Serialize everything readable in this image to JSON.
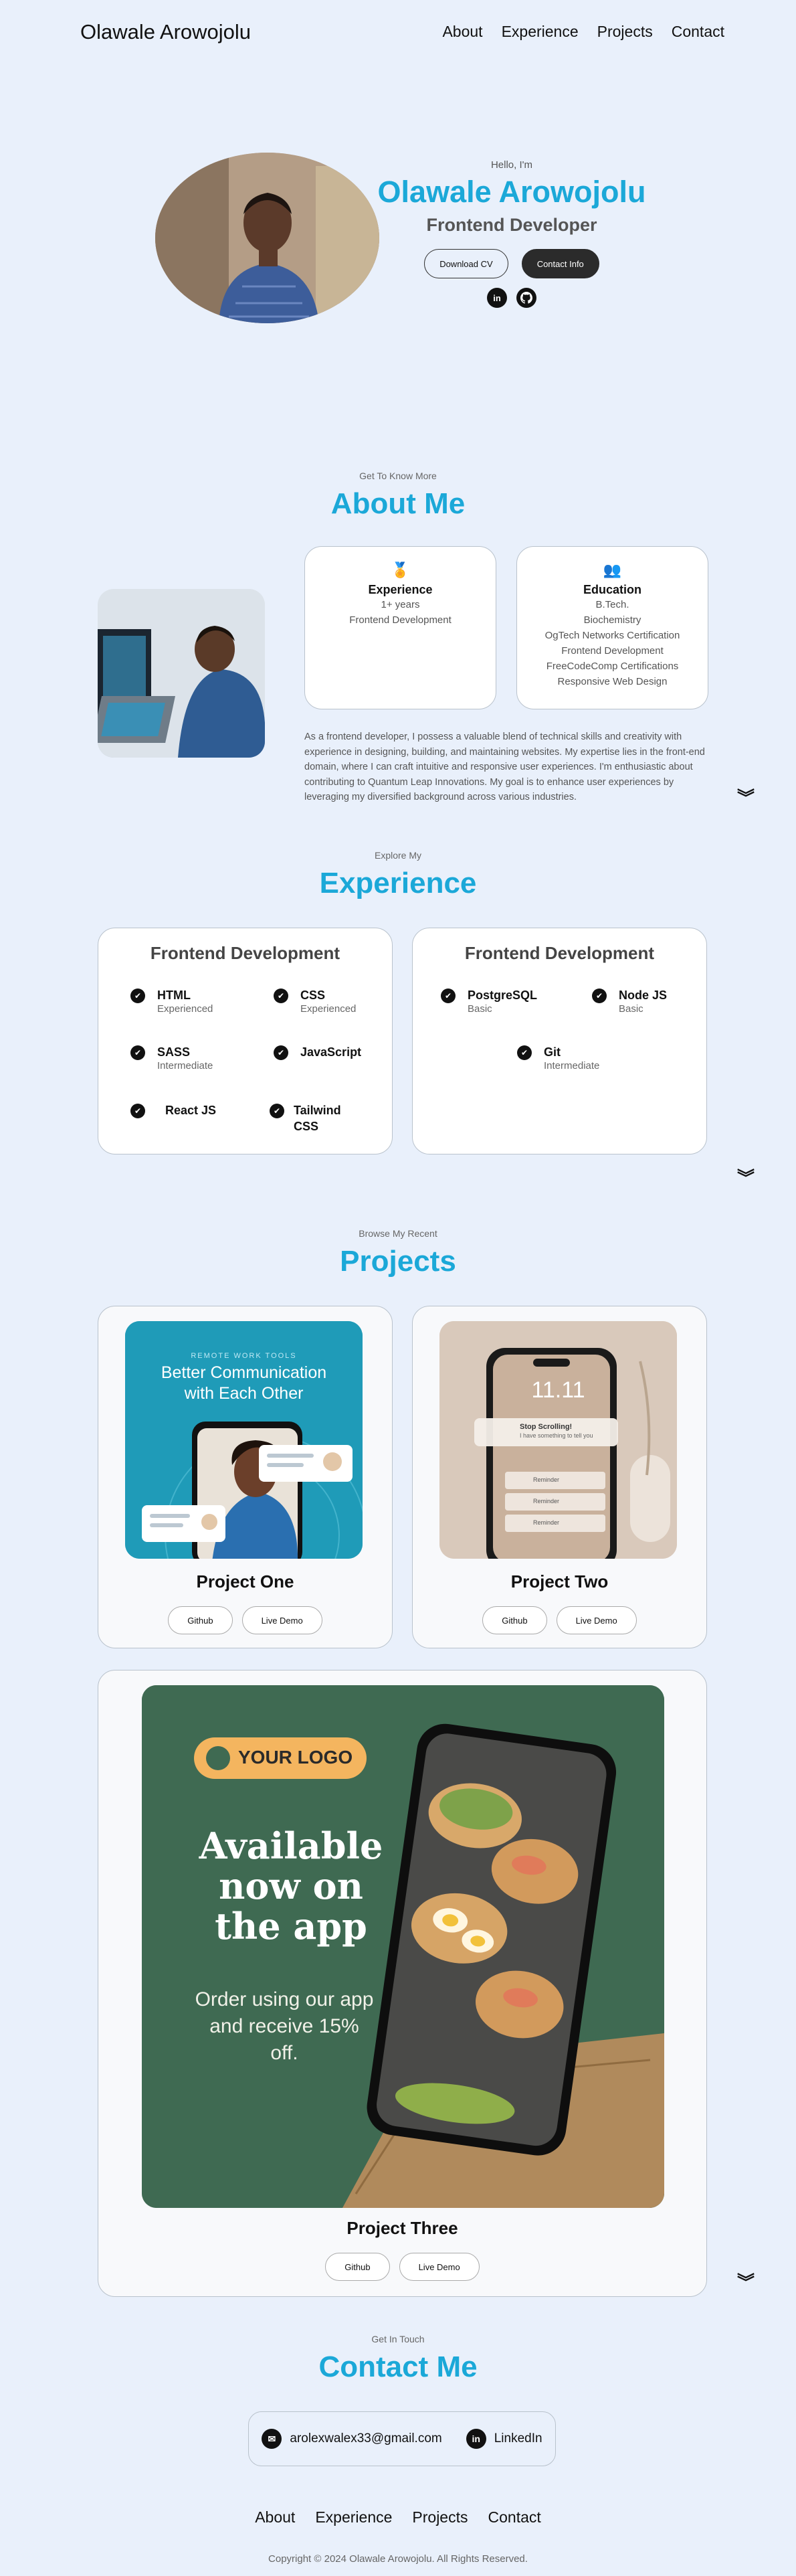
{
  "nav": {
    "logo": "Olawale Arowojolu",
    "links": [
      "About",
      "Experience",
      "Projects",
      "Contact"
    ]
  },
  "hero": {
    "greeting": "Hello, I'm",
    "name": "Olawale Arowojolu",
    "role": "Frontend Developer",
    "download_cv": "Download CV",
    "contact_info": "Contact Info",
    "social_icons": [
      "linkedin-icon",
      "github-icon"
    ]
  },
  "about": {
    "subtitle": "Get To Know More",
    "title": "About Me",
    "experience_card": {
      "icon": "medal-icon",
      "title": "Experience",
      "lines": [
        "1+ years",
        "Frontend Development"
      ]
    },
    "education_card": {
      "icon": "users-icon",
      "title": "Education",
      "lines": [
        "B.Tech.",
        "Biochemistry",
        "OgTech Networks Certification",
        "Frontend Development",
        "FreeCodeComp Certifications",
        "Responsive Web Design"
      ]
    },
    "paragraph": "As a frontend developer, I possess a valuable blend of technical skills and creativity with experience in designing, building, and maintaining websites. My expertise lies in the front-end domain, where I can craft intuitive and responsive user experiences. I'm enthusiastic about contributing to Quantum Leap Innovations. My goal is to enhance user experiences by leveraging my diversified background across various industries."
  },
  "experience": {
    "subtitle": "Explore My",
    "title": "Experience",
    "cards": [
      {
        "title": "Frontend Development",
        "skills": [
          {
            "name": "HTML",
            "level": "Experienced"
          },
          {
            "name": "CSS",
            "level": "Experienced"
          },
          {
            "name": "SASS",
            "level": "Intermediate"
          },
          {
            "name": "JavaScript",
            "level": ""
          },
          {
            "name": "React JS",
            "level": ""
          },
          {
            "name": "Tailwind CSS",
            "level": ""
          }
        ]
      },
      {
        "title": "Frontend Development",
        "skills": [
          {
            "name": "PostgreSQL",
            "level": "Basic"
          },
          {
            "name": "Node JS",
            "level": "Basic"
          },
          {
            "name": "Git",
            "level": "Intermediate"
          }
        ]
      }
    ]
  },
  "projects": {
    "subtitle": "Browse My Recent",
    "title": "Projects",
    "items": [
      {
        "title": "Project One",
        "github": "Github",
        "demo": "Live Demo",
        "image": {
          "kicker": "REMOTE WORK TOOLS",
          "headline": "Better Communication with Each Other"
        }
      },
      {
        "title": "Project Two",
        "github": "Github",
        "demo": "Live Demo",
        "image": {
          "time": "11.11",
          "notif_title": "Stop Scrolling!",
          "notif_body": "I have something to tell you",
          "reminder": "Reminder"
        }
      },
      {
        "title": "Project Three",
        "github": "Github",
        "demo": "Live Demo",
        "image": {
          "logo": "YOUR LOGO",
          "headline": "Available now on the app",
          "body": "Order using our app and receive 15% off."
        }
      }
    ]
  },
  "contact": {
    "subtitle": "Get In Touch",
    "title": "Contact Me",
    "email": "arolexwalex33@gmail.com",
    "linkedin": "LinkedIn"
  },
  "footer": {
    "links": [
      "About",
      "Experience",
      "Projects",
      "Contact"
    ],
    "copyright": "Copyright © 2024 Olawale Arowojolu. All Rights Reserved."
  },
  "colors": {
    "accent": "#1ba8d8",
    "background": "#e9f0fb",
    "project_one_bg": "#1f9bb8",
    "project_three_bg": "#3f6a52"
  }
}
